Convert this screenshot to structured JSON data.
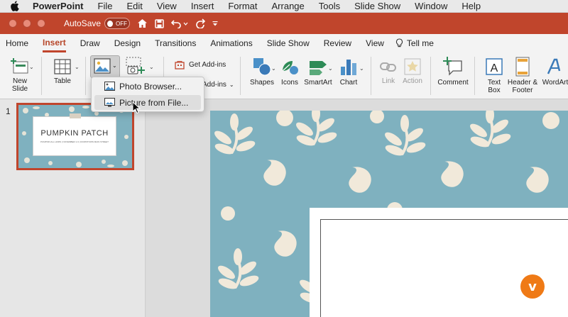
{
  "menubar": {
    "app": "PowerPoint",
    "items": [
      "File",
      "Edit",
      "View",
      "Insert",
      "Format",
      "Arrange",
      "Tools",
      "Slide Show",
      "Window",
      "Help"
    ]
  },
  "titlebar": {
    "autosave_label": "AutoSave",
    "autosave_state": "OFF"
  },
  "tabs": {
    "items": [
      "Home",
      "Insert",
      "Draw",
      "Design",
      "Transitions",
      "Animations",
      "Slide Show",
      "Review",
      "View"
    ],
    "active": "Insert",
    "tell_me": "Tell me"
  },
  "ribbon": {
    "new_slide": "New\nSlide",
    "table": "Table",
    "get_addins": "Get Add-ins",
    "my_addins": "Add-ins",
    "shapes": "Shapes",
    "icons": "Icons",
    "smartart": "SmartArt",
    "chart": "Chart",
    "link": "Link",
    "action": "Action",
    "comment": "Comment",
    "text_box": "Text\nBox",
    "header_footer": "Header &\nFooter",
    "wordart": "WordArt"
  },
  "dropdown": {
    "photo_browser": "Photo Browser...",
    "picture_from_file": "Picture from File..."
  },
  "thumbnails": {
    "slide_number": "1",
    "title": "PUMPKIN PATCH",
    "subtitle": "PUMPKIN ALL HORS | NOVEMBER 1-9 | DOWNTOWN MAIN STREET"
  },
  "colors": {
    "accent": "#c0452c",
    "slide_bg": "#7fb1bf",
    "pattern": "#f1e9da"
  }
}
